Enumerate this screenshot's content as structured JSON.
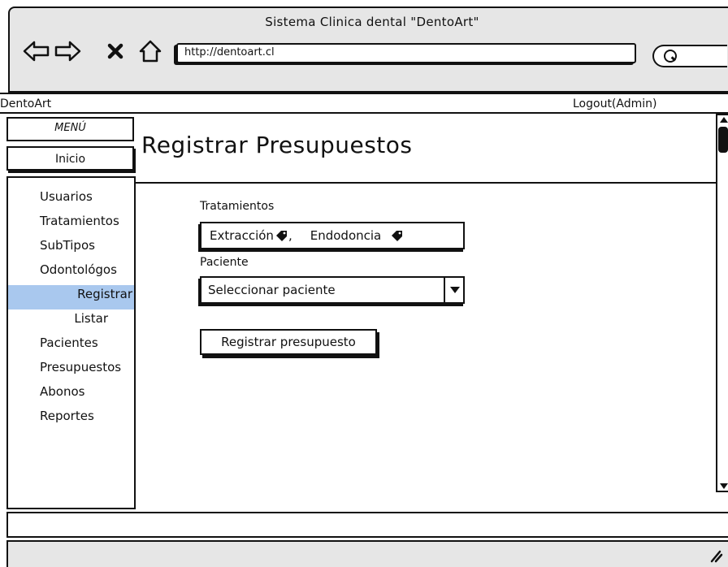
{
  "browser": {
    "window_title": "Sistema Clinica dental \"DentoArt\"",
    "url": "http://dentoart.cl",
    "back_icon": "arrow-left-icon",
    "forward_icon": "arrow-right-icon",
    "stop_icon": "close-icon",
    "home_icon": "home-icon",
    "search_icon": "search-icon"
  },
  "header": {
    "brand": "DentoArt",
    "logout": "Logout(Admin)"
  },
  "menu": {
    "label": "MENÚ",
    "home": "Inicio"
  },
  "sidebar": {
    "items": [
      {
        "label": "Usuarios"
      },
      {
        "label": "Tratamientos"
      },
      {
        "label": "SubTipos"
      },
      {
        "label": "Odontológos"
      },
      {
        "label": "Registrar"
      },
      {
        "label": "Listar"
      },
      {
        "label": "Pacientes"
      },
      {
        "label": "Presupuestos"
      },
      {
        "label": "Abonos"
      },
      {
        "label": "Reportes"
      }
    ],
    "active_color": "#a9c8ee"
  },
  "main": {
    "title": "Registrar Presupuestos",
    "tratamientos_label": "Tratamientos",
    "tags": [
      {
        "label": "Extracción",
        "icon": "tag-icon",
        "separator": ","
      },
      {
        "label": "Endodoncia",
        "icon": "tag-icon",
        "separator": ""
      }
    ],
    "paciente_label": "Paciente",
    "paciente_select": "Seleccionar paciente",
    "submit_label": "Registrar presupuesto"
  }
}
